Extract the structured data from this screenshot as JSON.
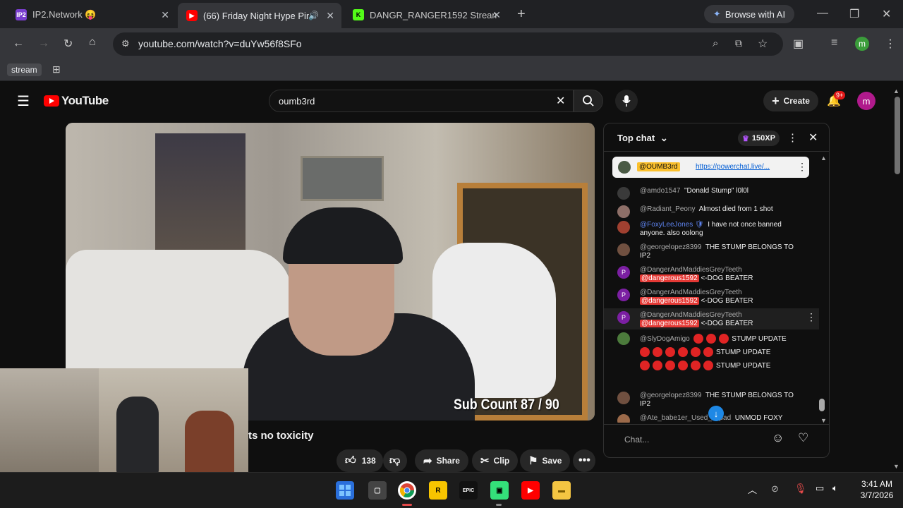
{
  "browser": {
    "tabs": [
      {
        "title": "IP2.Network 😝",
        "fav": "IP2"
      },
      {
        "title": "(66) Friday Night Hype Pint",
        "fav": "▶"
      },
      {
        "title": "DANGR_RANGER1592 Stream -",
        "fav": "K"
      }
    ],
    "browse_ai": "Browse with AI",
    "url": "youtube.com/watch?v=duYw56f8SFo",
    "bookmark": "stream",
    "profile_initial": "m"
  },
  "youtube": {
    "logo_text": "YouTube",
    "search_query": "oumb3rd",
    "create_label": "Create",
    "notif_count": "9+",
    "avatar_initial": "m",
    "video": {
      "sub_count": "Sub Count  87 / 90",
      "title_fragment": "ts no toxicity",
      "likes": "138",
      "share": "Share",
      "clip": "Clip",
      "save": "Save"
    },
    "chat": {
      "mode": "Top chat",
      "xp": "150XP",
      "pinned_tag": "@OUMB3rd",
      "pinned_link": "https://powerchat.live/...",
      "messages": [
        {
          "author": "@amdo1547",
          "text": "\"Donald Stump\" l0l0l"
        },
        {
          "author": "@Radiant_Peony",
          "text": "Almost died from 1 shot"
        },
        {
          "author": "@FoxyLeeJones",
          "text": "I have not once banned anyone. also oolong"
        },
        {
          "author": "@georgelopez8399",
          "text": "THE STUMP BELONGS TO IP2"
        },
        {
          "author": "@DangerAndMaddiesGreyTeeth",
          "mention": "@dangerous1592",
          "text": "<-DOG BEATER"
        },
        {
          "author": "@DangerAndMaddiesGreyTeeth",
          "mention": "@dangerous1592",
          "text": "<-DOG BEATER"
        },
        {
          "author": "@DangerAndMaddiesGreyTeeth",
          "mention": "@dangerous1592",
          "text": "<-DOG BEATER"
        },
        {
          "author": "@SlyDogAmigo",
          "text": "STUMP UPDATE",
          "text2": "STUMP UPDATE",
          "text3": "STUMP UPDATE"
        },
        {
          "author": "@georgelopez8399",
          "text": "THE STUMP BELONGS TO IP2"
        },
        {
          "author": "@Ate_babe1er_Used_...ipad",
          "text": "UNMOD FOXY"
        }
      ],
      "input_placeholder": "Chat...",
      "avatar_letter": "P"
    }
  },
  "taskbar": {
    "time": "3:41 AM",
    "date": "3/7/2026"
  },
  "colors": {
    "accent_red": "#ff0000",
    "chat_mention": "#e53935"
  }
}
